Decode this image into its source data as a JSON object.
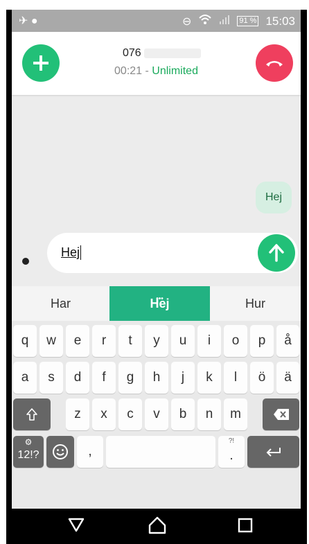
{
  "status_bar": {
    "battery": "91 %",
    "time": "15:03"
  },
  "call": {
    "number_prefix": "076",
    "duration": "00:21",
    "separator": " - ",
    "plan": "Unlimited",
    "colors": {
      "add": "#22c078",
      "hangup": "#ef3f5e",
      "plan_text": "#1aaa5c"
    }
  },
  "chat": {
    "messages": [
      {
        "text": "Hej",
        "outgoing": true
      }
    ]
  },
  "composer": {
    "value": "Hej"
  },
  "suggestions": [
    "Har",
    "Hej",
    "Hur"
  ],
  "keyboard": {
    "row1": [
      "q",
      "w",
      "e",
      "r",
      "t",
      "y",
      "u",
      "i",
      "o",
      "p",
      "å"
    ],
    "row2": [
      "a",
      "s",
      "d",
      "f",
      "g",
      "h",
      "j",
      "k",
      "l",
      "ö",
      "ä"
    ],
    "row3": [
      "z",
      "x",
      "c",
      "v",
      "b",
      "n",
      "m"
    ],
    "symbols_label": "12!?",
    "comma": ",",
    "period": ".",
    "period_alt": "?!",
    "accent": "#22b282"
  }
}
